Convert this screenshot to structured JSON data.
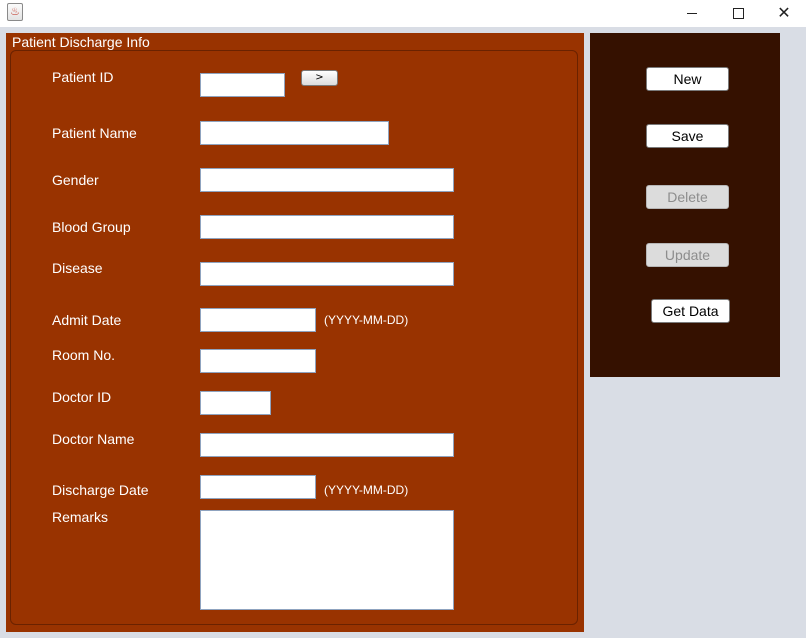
{
  "window": {
    "icon_glyph": "♨",
    "controls": {
      "minimize_icon": "minimize-icon",
      "maximize_icon": "maximize-icon",
      "close_glyph": "✕"
    }
  },
  "form": {
    "title": "Patient Discharge Info",
    "patient_id_label": "Patient ID",
    "lookup_label": ">",
    "patient_name_label": "Patient Name",
    "gender_label": "Gender",
    "blood_group_label": "Blood Group",
    "disease_label": "Disease",
    "admit_date_label": "Admit Date",
    "admit_date_hint": "(YYYY-MM-DD)",
    "room_no_label": "Room No.",
    "doctor_id_label": "Doctor ID",
    "doctor_name_label": "Doctor Name",
    "discharge_date_label": "Discharge Date",
    "discharge_date_hint": "(YYYY-MM-DD)",
    "remarks_label": "Remarks",
    "values": {
      "patient_id": "",
      "patient_name": "",
      "gender": "",
      "blood_group": "",
      "disease": "",
      "admit_date": "",
      "room_no": "",
      "doctor_id": "",
      "doctor_name": "",
      "discharge_date": "",
      "remarks": ""
    }
  },
  "actions": {
    "new_label": "New",
    "save_label": "Save",
    "delete_label": "Delete",
    "update_label": "Update",
    "get_data_label": "Get Data"
  },
  "colors": {
    "form_background": "#993300",
    "action_background": "#351100",
    "window_background": "#d9dde5"
  }
}
